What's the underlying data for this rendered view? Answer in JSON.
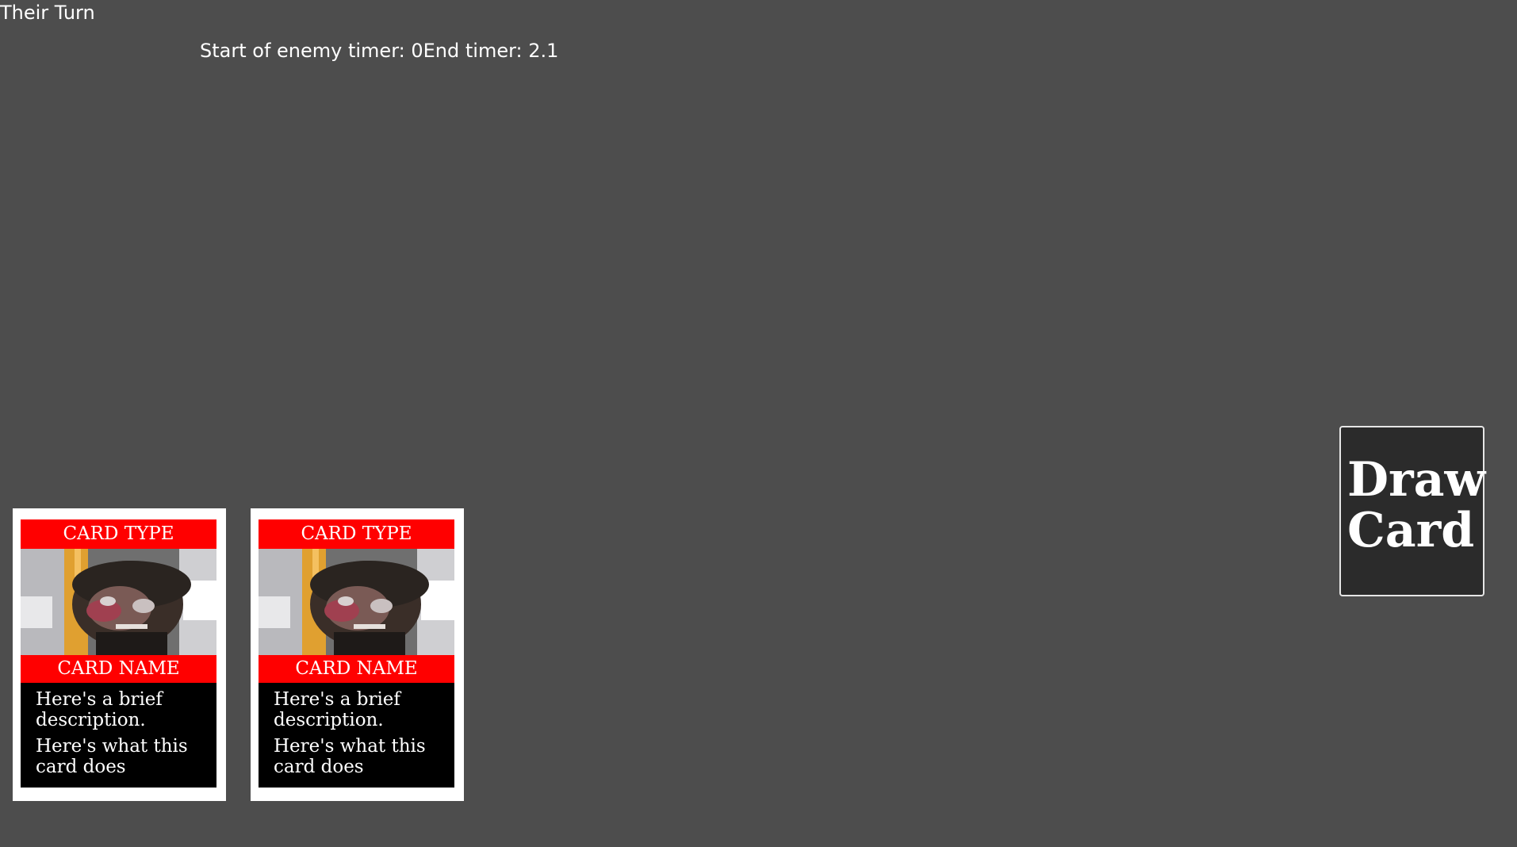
{
  "hud": {
    "turn": "Their Turn",
    "timer": "Start of enemy timer: 0End timer: 2.1"
  },
  "hand": {
    "cards": [
      {
        "type": "CARD TYPE",
        "name": "CARD NAME",
        "description": "Here's a brief description.",
        "effect": "Here's what this card does"
      },
      {
        "type": "CARD TYPE",
        "name": "CARD NAME",
        "description": "Here's a brief description.",
        "effect": "Here's what this card does"
      }
    ]
  },
  "draw_button": {
    "line1": "Draw",
    "line2": "Card"
  },
  "colors": {
    "background": "#4d4d4d",
    "card_banner": "#ff0000",
    "card_body": "#000000",
    "button_fill": "#2b2b2b"
  }
}
